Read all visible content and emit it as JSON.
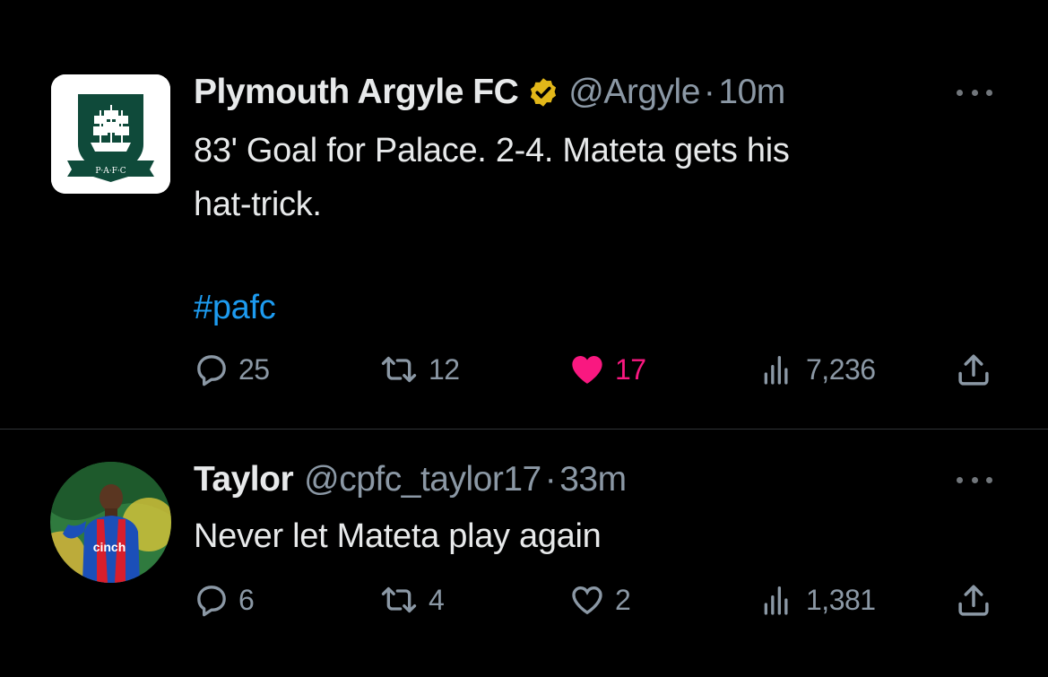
{
  "tweets": [
    {
      "name": "Plymouth Argyle FC",
      "verified": true,
      "handle": "@Argyle",
      "separator": "·",
      "time": "10m",
      "text_lines": [
        "83' Goal for Palace. 2-4. Mateta gets his",
        "hat-trick."
      ],
      "hashtag": "#pafc",
      "avatar_icon": "pafc-crest-icon",
      "avatar_text": "P·A·F·C",
      "stats": {
        "replies": "25",
        "retweets": "12",
        "likes": "17",
        "views": "7,236"
      },
      "liked": true
    },
    {
      "name": "Taylor",
      "verified": false,
      "handle": "@cpfc_taylor17",
      "separator": "·",
      "time": "33m",
      "text_lines": [
        "Never let Mateta play again"
      ],
      "avatar_icon": "profile-photo-icon",
      "avatar_text": "cinch",
      "stats": {
        "replies": "6",
        "retweets": "4",
        "likes": "2",
        "views": "1,381"
      },
      "liked": false
    }
  ],
  "colors": {
    "background": "#000000",
    "text": "#e7e9ea",
    "muted": "#8b98a5",
    "link": "#1d9bf0",
    "like": "#f91880",
    "verified_badge": "#e2b719",
    "divider": "#2f3336"
  }
}
